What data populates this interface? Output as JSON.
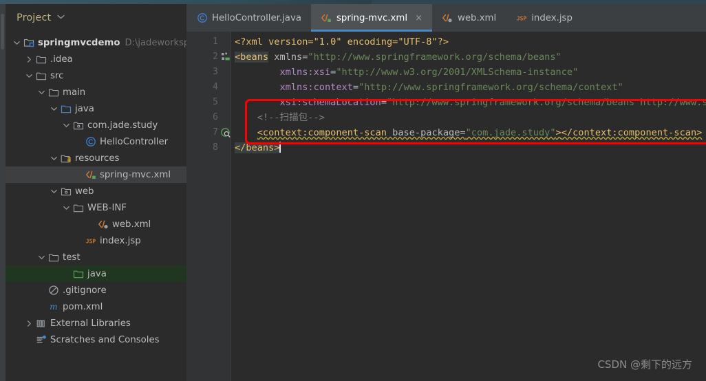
{
  "window": {
    "theme_bg": "#2b2b2b",
    "accent": "#4a88c7",
    "annotation_color": "#ff0000"
  },
  "sidebar": {
    "title": "Project",
    "chevron_icon": "chevron-down-icon",
    "tree": [
      {
        "label": "springmvcdemo",
        "suffix": "D:\\jadeworkspac",
        "indent": 0,
        "twisty": "expanded",
        "icon": "module-icon",
        "bold": true,
        "state": "normal"
      },
      {
        "label": ".idea",
        "suffix": "",
        "indent": 1,
        "twisty": "collapsed",
        "icon": "folder-icon",
        "bold": false,
        "state": "normal"
      },
      {
        "label": "src",
        "suffix": "",
        "indent": 1,
        "twisty": "expanded",
        "icon": "folder-icon",
        "bold": false,
        "state": "normal"
      },
      {
        "label": "main",
        "suffix": "",
        "indent": 2,
        "twisty": "expanded",
        "icon": "folder-icon",
        "bold": false,
        "state": "normal"
      },
      {
        "label": "java",
        "suffix": "",
        "indent": 3,
        "twisty": "expanded",
        "icon": "source-root-icon",
        "bold": false,
        "state": "normal"
      },
      {
        "label": "com.jade.study",
        "suffix": "",
        "indent": 4,
        "twisty": "expanded",
        "icon": "package-icon",
        "bold": false,
        "state": "normal"
      },
      {
        "label": "HelloController",
        "suffix": "",
        "indent": 5,
        "twisty": "none",
        "icon": "java-class-icon",
        "bold": false,
        "state": "normal"
      },
      {
        "label": "resources",
        "suffix": "",
        "indent": 3,
        "twisty": "expanded",
        "icon": "resources-root-icon",
        "bold": false,
        "state": "normal"
      },
      {
        "label": "spring-mvc.xml",
        "suffix": "",
        "indent": 5,
        "twisty": "none",
        "icon": "xml-spring-icon",
        "bold": false,
        "state": "selected"
      },
      {
        "label": "web",
        "suffix": "",
        "indent": 3,
        "twisty": "expanded",
        "icon": "package-icon",
        "bold": false,
        "state": "normal"
      },
      {
        "label": "WEB-INF",
        "suffix": "",
        "indent": 4,
        "twisty": "expanded",
        "icon": "folder-icon",
        "bold": false,
        "state": "normal"
      },
      {
        "label": "web.xml",
        "suffix": "",
        "indent": 6,
        "twisty": "none",
        "icon": "xml-web-icon",
        "bold": false,
        "state": "normal"
      },
      {
        "label": "index.jsp",
        "suffix": "",
        "indent": 5,
        "twisty": "none",
        "icon": "jsp-icon",
        "bold": false,
        "state": "normal"
      },
      {
        "label": "test",
        "suffix": "",
        "indent": 2,
        "twisty": "expanded",
        "icon": "folder-icon",
        "bold": false,
        "state": "normal"
      },
      {
        "label": "java",
        "suffix": "",
        "indent": 4,
        "twisty": "none",
        "icon": "test-source-root-icon",
        "bold": false,
        "state": "test-root"
      },
      {
        "label": ".gitignore",
        "suffix": "",
        "indent": 2,
        "twisty": "none",
        "icon": "gitignore-icon",
        "bold": false,
        "state": "normal"
      },
      {
        "label": "pom.xml",
        "suffix": "",
        "indent": 2,
        "twisty": "none",
        "icon": "maven-icon",
        "bold": false,
        "state": "normal"
      },
      {
        "label": "External Libraries",
        "suffix": "",
        "indent": 1,
        "twisty": "collapsed",
        "icon": "library-icon",
        "bold": false,
        "state": "normal"
      },
      {
        "label": "Scratches and Consoles",
        "suffix": "",
        "indent": 1,
        "twisty": "none",
        "icon": "scratches-icon",
        "bold": false,
        "state": "normal"
      }
    ]
  },
  "editor": {
    "tabs": [
      {
        "label": "HelloController.java",
        "icon": "java-class-icon",
        "active": false,
        "closable": false
      },
      {
        "label": "spring-mvc.xml",
        "icon": "xml-spring-icon",
        "active": true,
        "closable": true,
        "close_label": "×"
      },
      {
        "label": "web.xml",
        "icon": "xml-web-icon",
        "active": false,
        "closable": false
      },
      {
        "label": "index.jsp",
        "icon": "jsp-icon",
        "active": false,
        "closable": false
      }
    ],
    "file_name": "spring-mvc.xml",
    "lines": [
      {
        "number": "1",
        "gutter_icon": "none"
      },
      {
        "number": "2",
        "gutter_icon": "spring-beans-gutter-icon"
      },
      {
        "number": "3",
        "gutter_icon": "none"
      },
      {
        "number": "4",
        "gutter_icon": "none"
      },
      {
        "number": "5",
        "gutter_icon": "none"
      },
      {
        "number": "6",
        "gutter_icon": "none"
      },
      {
        "number": "7",
        "gutter_icon": "spring-scan-gutter-icon"
      },
      {
        "number": "8",
        "gutter_icon": "none"
      }
    ],
    "code_text": {
      "l1": "<?xml version=\"1.0\" encoding=\"UTF-8\"?>",
      "l2_tag": "<beans",
      "l2_attr": " xmlns=",
      "l2_val": "\"http://www.springframework.org/schema/beans\"",
      "l3_ns": "xmlns:xsi",
      "l3_eq": "=",
      "l3_val": "\"http://www.w3.org/2001/XMLSchema-instance\"",
      "l4_ns": "xmlns:context",
      "l4_eq": "=",
      "l4_val": "\"http://www.springframework.org/schema/context\"",
      "l5_ns": "xsi:schemaLocation",
      "l5_eq": "=",
      "l5_val": "\"http://www.springframework.org/schema/beans http://www.spr",
      "l6_comment": "<!--扫描包-->",
      "l7_open": "<context:component-scan",
      "l7_attr": " base-package=",
      "l7_val": "\"com.jade.study\"",
      "l7_gt": ">",
      "l7_close": "</context:component-scan>",
      "l8_close": "</beans>"
    },
    "annotation": {
      "name": "red-highlight-box",
      "color": "#ff0000"
    }
  },
  "watermark": {
    "text": "CSDN @剩下的远方"
  }
}
